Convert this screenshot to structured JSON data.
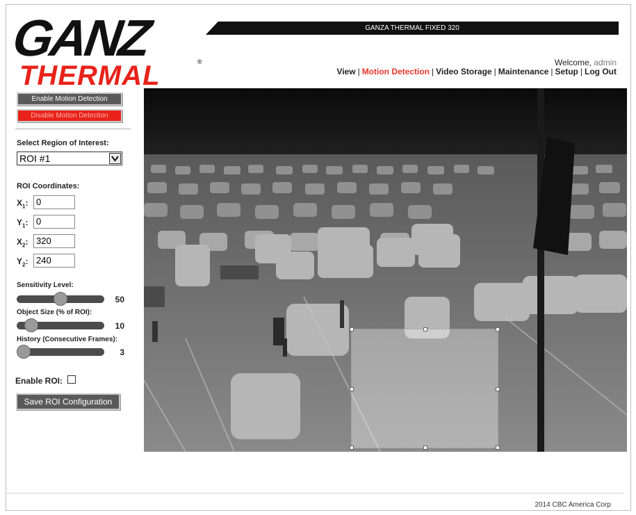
{
  "brand": {
    "logo_word1": "GANZ",
    "logo_word2": "THERMAL",
    "logo_mark": "®",
    "color_dark": "#111111",
    "color_red": "#e8221a"
  },
  "header": {
    "title": "GANZA THERMAL FIXED 320",
    "welcome_prefix": "Welcome,",
    "username": "admin",
    "nav": [
      "View",
      "Motion Detection",
      "Video Storage",
      "Maintenance",
      "Setup",
      "Log Out"
    ],
    "nav_active": "Motion Detection"
  },
  "sidebar": {
    "enable_md_label": "Enable Motion Detection",
    "disable_md_label": "Disable Motion Detection",
    "roi_select_label": "Select Region of Interest:",
    "roi_selected": "ROI #1",
    "coords_label": "ROI Coordinates:",
    "coords": [
      {
        "label": "X",
        "sub": "1",
        "value": "0"
      },
      {
        "label": "Y",
        "sub": "1",
        "value": "0"
      },
      {
        "label": "X",
        "sub": "2",
        "value": "320"
      },
      {
        "label": "Y",
        "sub": "2",
        "value": "240"
      }
    ],
    "sliders": [
      {
        "label": "Sensitivity Level:",
        "value": "50",
        "fraction": 0.5
      },
      {
        "label": "Object Size (% of ROI):",
        "value": "10",
        "fraction": 0.1
      },
      {
        "label": "History (Consecutive Frames):",
        "value": "3",
        "fraction": 0.0
      }
    ],
    "enable_roi_label": "Enable ROI:",
    "enable_roi_checked": false,
    "save_label": "Save ROI Configuration"
  },
  "footer": {
    "copyright": "2014 CBC America Corp"
  }
}
